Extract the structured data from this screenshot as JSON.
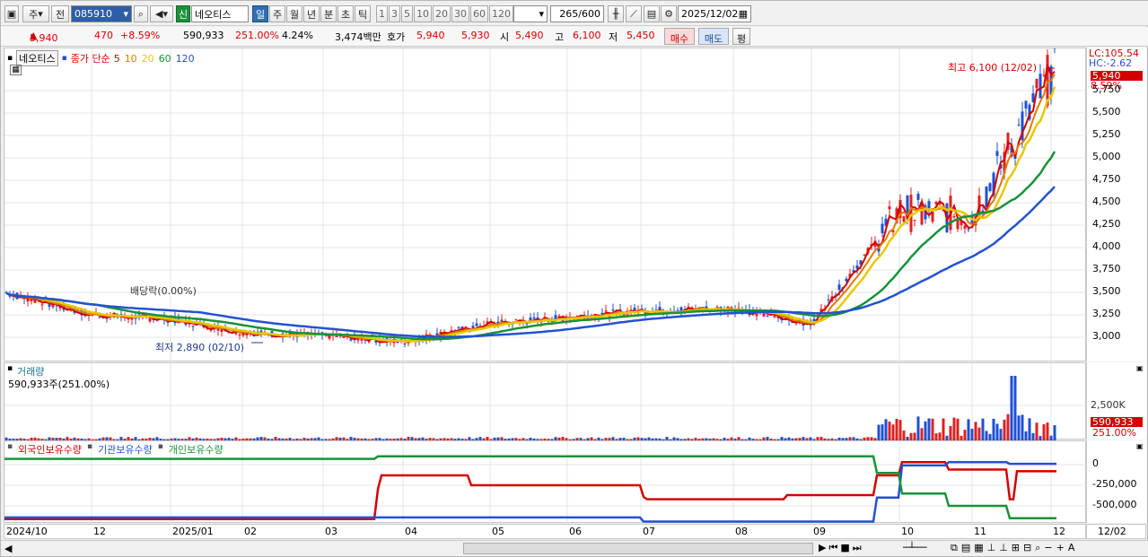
{
  "toolbar": {
    "tab1": "주",
    "tab2": "전",
    "code": "085910",
    "new_badge": "신",
    "stock_name": "네오티스",
    "periods": [
      "일",
      "주",
      "월",
      "년",
      "분",
      "초",
      "틱"
    ],
    "nums": [
      "1",
      "3",
      "5",
      "10",
      "20",
      "30",
      "60",
      "120"
    ],
    "count": "265",
    "count_total": "/600",
    "date": "2025/12/02"
  },
  "quote": {
    "price": "5,940",
    "change": "470",
    "rate": "+8.59%",
    "volume": "590,933",
    "vol_rate": "251.00%",
    "turnover": "4.24%",
    "amount": "3,474백만",
    "hoga_label": "호가",
    "ask": "5,940",
    "bid": "5,930",
    "open_label": "시",
    "open": "5,490",
    "high_label": "고",
    "high": "6,100",
    "low_label": "저",
    "low": "5,450",
    "buy": "매수",
    "sell": "매도",
    "eval": "평"
  },
  "price_panel": {
    "stock": "네오티스",
    "legend_prefix": "종가 단순",
    "ma": [
      "5",
      "10",
      "20",
      "60",
      "120"
    ],
    "ma_colors": [
      "#d40000",
      "#e07a00",
      "#e6c800",
      "#18923a",
      "#2451d1"
    ],
    "hi_note": "최고 6,100 (12/02)",
    "lo_note": "최저 2,890 (02/10)",
    "div_note": "배당락(0.00%)",
    "lc": "LC:105.54",
    "hc": "HC:-2.62",
    "last_price": "5,940",
    "last_rate": "8.59%",
    "yticks": [
      "5,750",
      "5,500",
      "5,250",
      "5,000",
      "4,750",
      "4,500",
      "4,250",
      "4,000",
      "3,750",
      "3,500",
      "3,250",
      "3,000"
    ]
  },
  "volume_panel": {
    "title": "거래량",
    "value": "590,933주(251.00%)",
    "tick": "2,500K",
    "last": "590,933",
    "last_rate": "251.00%"
  },
  "holding_panel": {
    "legend": [
      "외국인보유수량",
      "기관보유수량",
      "개인보유수량"
    ],
    "colors": [
      "#d40000",
      "#2451d1",
      "#18923a"
    ],
    "yticks": [
      "0",
      "-250,000",
      "-500,000"
    ]
  },
  "xaxis": {
    "labels": [
      "2024/10",
      "12",
      "2025/01",
      "02",
      "03",
      "04",
      "05",
      "06",
      "07",
      "08",
      "09",
      "10",
      "11",
      "12"
    ],
    "right": "12/02"
  },
  "chart_data": {
    "type": "line",
    "title": "",
    "x": [
      "2024/10",
      "12",
      "2025/01",
      "02",
      "03",
      "04",
      "05",
      "06",
      "07",
      "08",
      "09",
      "10",
      "11",
      "12"
    ],
    "series": [
      {
        "name": "종가",
        "values": [
          3500,
          3250,
          3200,
          3050,
          3020,
          2950,
          3150,
          3220,
          3300,
          3320,
          3150,
          4400,
          4350,
          5940
        ]
      }
    ],
    "ylim": [
      2800,
      6200
    ]
  }
}
